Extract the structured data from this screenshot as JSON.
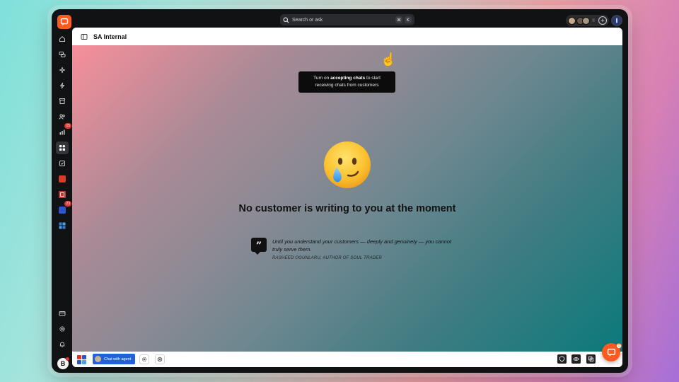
{
  "topbar": {
    "search_placeholder": "Search or ask",
    "shortcut_key1": "⌘",
    "shortcut_key2": "K",
    "separator": "II",
    "add_label": "+"
  },
  "sidebar": {
    "items": [
      {
        "icon": "home-icon"
      },
      {
        "icon": "chats-icon"
      },
      {
        "icon": "sparkle-icon"
      },
      {
        "icon": "lightning-icon"
      },
      {
        "icon": "archive-icon"
      },
      {
        "icon": "customers-icon"
      },
      {
        "icon": "reports-icon",
        "badge": "15"
      },
      {
        "icon": "apps-icon",
        "active": true
      },
      {
        "icon": "tasks-icon"
      },
      {
        "icon": "app-red-icon"
      },
      {
        "icon": "app-video-icon"
      },
      {
        "icon": "app-blue-icon",
        "badge": "23"
      },
      {
        "icon": "app-grid-icon"
      }
    ],
    "bottom_items": [
      {
        "icon": "billing-icon"
      },
      {
        "icon": "settings-icon"
      },
      {
        "icon": "bell-icon"
      }
    ],
    "avatar_initial": "B"
  },
  "header": {
    "title": "SA Internal"
  },
  "content": {
    "tooltip_prefix": "Turn on ",
    "tooltip_bold": "accepting chats",
    "tooltip_line1_suffix": " to start",
    "tooltip_line2": "receiving chats from customers",
    "empty_title": "No customer is writing to you at the moment",
    "quote_mark": "”",
    "quote_text": "Until you understand your customers — deeply and genuinely — you cannot truly serve them.",
    "quote_author": "RASHEED OGUNLARU, AUTHOR OF SOUL TRADER"
  },
  "bottombar": {
    "chat_with_agent": "Chat with agent"
  },
  "fab": {
    "badge": "0"
  },
  "colors": {
    "brand": "#ff5a1f",
    "badge": "#e5322d",
    "primary_button": "#2162d7"
  }
}
